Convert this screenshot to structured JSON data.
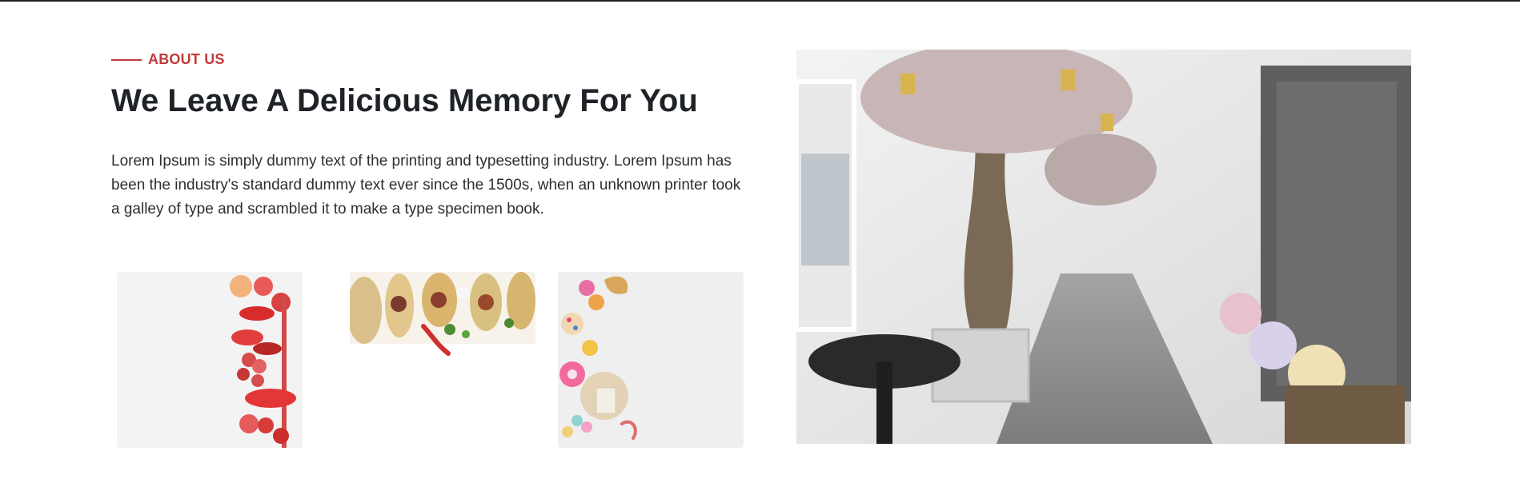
{
  "section": {
    "kicker": "ABOUT US",
    "headline": "We Leave A Delicious Memory For You",
    "body": "Lorem Ipsum is simply dummy text of the printing and typesetting industry. Lorem Ipsum has been the industry's standard dummy text ever since the 1500s, when an unknown printer took a galley of type and scrambled it to make a type specimen book."
  },
  "colors": {
    "accent": "#c23a3a",
    "heading": "#1f2328",
    "text": "#2b2f33"
  },
  "images": {
    "thumb_1": "red-fruits-and-vegetables-image",
    "thumb_2": "tacos-image",
    "thumb_3": "sweets-and-candy-image",
    "hero": "restaurant-interior-with-trees-image"
  }
}
